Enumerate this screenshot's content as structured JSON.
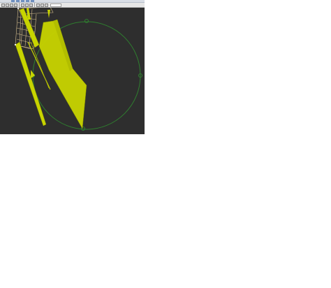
{
  "app": {
    "background": "#2e2e2e",
    "menubar_color": "#d9dee6",
    "toolbar_color": "#e6e6e6"
  },
  "toolbar": {
    "zoom_value": "",
    "tools": [
      {
        "name": "select-tool-icon"
      },
      {
        "name": "move-tool-icon"
      },
      {
        "name": "rotate-tool-icon"
      },
      {
        "name": "scale-tool-icon"
      },
      {
        "name": "separator"
      },
      {
        "name": "pan-tool-icon"
      },
      {
        "name": "orbit-tool-icon"
      },
      {
        "name": "zoom-tool-icon"
      },
      {
        "name": "separator"
      },
      {
        "name": "grid-toggle-icon"
      },
      {
        "name": "snap-toggle-icon"
      },
      {
        "name": "render-mode-icon"
      }
    ]
  },
  "viewport": {
    "mesh_color": "#c8d400",
    "gizmo_color": "#2f7f2f",
    "wire_color": "#d8c090"
  }
}
